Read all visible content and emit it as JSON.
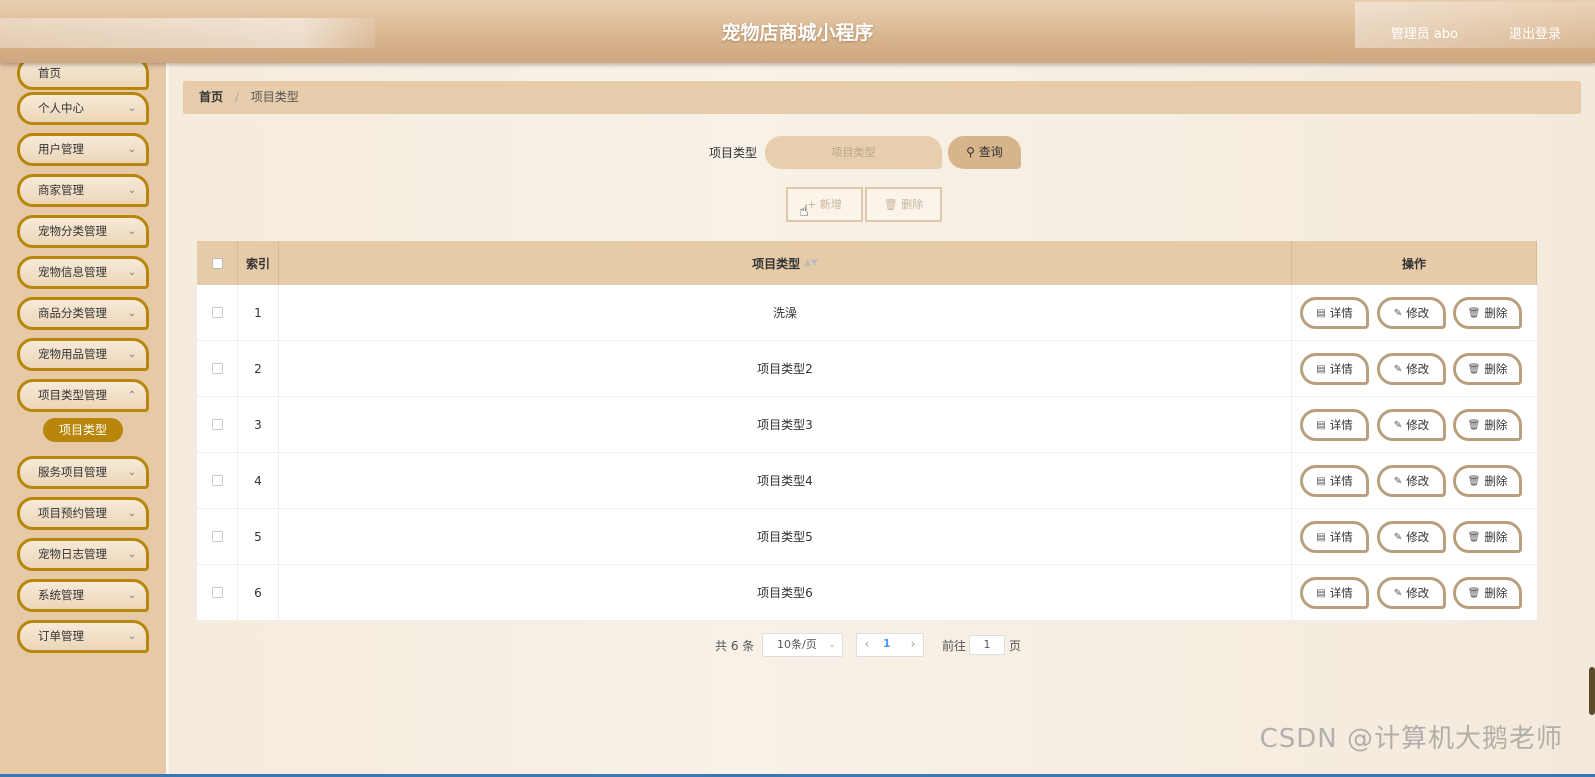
{
  "header": {
    "title": "宠物店商城小程序",
    "user": "管理员 abo",
    "logout": "退出登录"
  },
  "sidebar": {
    "items": [
      {
        "label": "首页"
      },
      {
        "label": "个人中心"
      },
      {
        "label": "用户管理"
      },
      {
        "label": "商家管理"
      },
      {
        "label": "宠物分类管理"
      },
      {
        "label": "宠物信息管理"
      },
      {
        "label": "商品分类管理"
      },
      {
        "label": "宠物用品管理"
      },
      {
        "label": "项目类型管理"
      },
      {
        "label": "服务项目管理"
      },
      {
        "label": "项目预约管理"
      },
      {
        "label": "宠物日志管理"
      },
      {
        "label": "系统管理"
      },
      {
        "label": "订单管理"
      }
    ],
    "active_sub": "项目类型"
  },
  "breadcrumb": {
    "home": "首页",
    "current": "项目类型"
  },
  "search": {
    "label": "项目类型",
    "placeholder": "项目类型",
    "query_button": "查询"
  },
  "actions": {
    "add": "新增",
    "delete": "删除"
  },
  "table": {
    "columns": {
      "index": "索引",
      "type": "项目类型",
      "ops": "操作"
    },
    "rows": [
      {
        "index": "1",
        "type": "洗澡"
      },
      {
        "index": "2",
        "type": "项目类型2"
      },
      {
        "index": "3",
        "type": "项目类型3"
      },
      {
        "index": "4",
        "type": "项目类型4"
      },
      {
        "index": "5",
        "type": "项目类型5"
      },
      {
        "index": "6",
        "type": "项目类型6"
      }
    ],
    "op_labels": {
      "detail": "详情",
      "edit": "修改",
      "delete": "删除"
    }
  },
  "pagination": {
    "total": "共 6 条",
    "page_size": "10条/页",
    "current_page": "1",
    "goto_label": "前往",
    "goto_value": "1",
    "page_unit": "页"
  },
  "watermark": "CSDN @计算机大鹅老师"
}
